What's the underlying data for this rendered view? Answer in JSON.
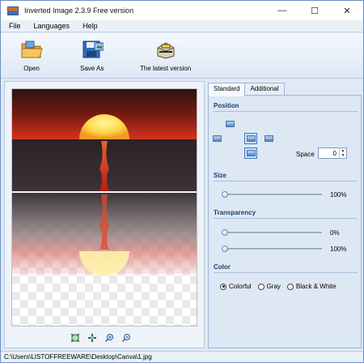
{
  "window": {
    "title": "Inverted Image 2.3.9 Free version",
    "minimize_glyph": "—",
    "maximize_glyph": "☐",
    "close_glyph": "✕"
  },
  "menu": [
    "File",
    "Languages",
    "Help"
  ],
  "toolbar": {
    "open_label": "Open",
    "save_as_label": "Save As",
    "latest_label": "The latest version"
  },
  "tabs": [
    "Standard",
    "Additional"
  ],
  "position": {
    "title": "Position",
    "space_label": "Space",
    "space_value": "0",
    "selected": "center"
  },
  "size": {
    "title": "Size",
    "value_label": "100%",
    "value": 1.0
  },
  "transparency": {
    "title": "Transparency",
    "first_label": "0%",
    "first_value": 0.0,
    "second_label": "100%",
    "second_value": 1.0
  },
  "color": {
    "title": "Color",
    "options": [
      "Colorful",
      "Gray",
      "Black & White"
    ],
    "selected": "Colorful"
  },
  "status": {
    "path": "C:\\Users\\LISTOFFREEWARE\\Desktop\\Canva\\1.jpg"
  },
  "icons": {
    "open": "folder-open-icon",
    "save": "floppy-disk-icon",
    "latest": "update-box-icon",
    "zoom": [
      "fit-icon",
      "actual-size-icon",
      "zoom-in-icon",
      "zoom-out-icon"
    ]
  },
  "colors": {
    "accent": "#1b3d6f",
    "panel": "#dde8f4",
    "sun": "#ffe05a",
    "sunset_red": "#e0281a"
  }
}
